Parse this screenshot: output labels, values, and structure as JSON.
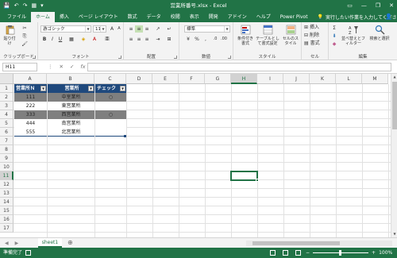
{
  "window": {
    "title": "営業所番号.xlsx - Excel",
    "qat": [
      "💾",
      "↶",
      "↷",
      "▦",
      "▾"
    ],
    "controls": [
      "▭",
      "—",
      "❐",
      "✕"
    ]
  },
  "ribbon_tabs": [
    "ファイル",
    "ホーム",
    "挿入",
    "ページ レイアウト",
    "数式",
    "データ",
    "校閲",
    "表示",
    "開発",
    "アドイン",
    "ヘルプ",
    "Power Pivot"
  ],
  "tell_me": "実行したい作業を入力してください",
  "ribbon": {
    "paste_label": "貼り付け",
    "font_name": "游ゴシック",
    "font_size": "11",
    "number_format": "標準",
    "conditional_format": "条件付き書式",
    "format_as_table": "テーブルとして書式設定",
    "cell_styles": "セルのスタイル",
    "insert": "挿入",
    "delete": "削除",
    "format": "書式",
    "sort_filter": "並べ替えとフィルター",
    "find_select": "検索と選択",
    "group_labels": {
      "clipboard": "クリップボード",
      "font": "フォント",
      "alignment": "配置",
      "number": "数値",
      "styles": "スタイル",
      "cells": "セル",
      "editing": "編集"
    }
  },
  "formula_bar": {
    "name_box": "H11",
    "icons": [
      "⋮",
      "✕",
      "✓",
      "fx"
    ],
    "value": ""
  },
  "columns": [
    "A",
    "B",
    "C",
    "D",
    "E",
    "F",
    "G",
    "H",
    "I",
    "J",
    "K",
    "L",
    "M"
  ],
  "selected_column": "H",
  "rows": [
    "1",
    "2",
    "3",
    "4",
    "5",
    "6",
    "7",
    "8",
    "9",
    "10",
    "11",
    "12",
    "13",
    "14",
    "15",
    "16",
    "17"
  ],
  "selected_row": "11",
  "table": {
    "headers": [
      "営業所Ｎ",
      "営業所",
      "チェック"
    ],
    "rows": [
      [
        "111",
        "中室業所",
        "○"
      ],
      [
        "222",
        "東営業所",
        ""
      ],
      [
        "333",
        "西営業所",
        "○"
      ],
      [
        "444",
        "南営業所",
        ""
      ],
      [
        "555",
        "北営業所",
        ""
      ]
    ]
  },
  "sheet_tab": "sheet1",
  "status": {
    "ready": "準備完了",
    "zoom": "100%"
  },
  "colors": {
    "excel_green": "#217346",
    "table_header": "#1f497d",
    "row_gray": "#7f7f7f"
  }
}
